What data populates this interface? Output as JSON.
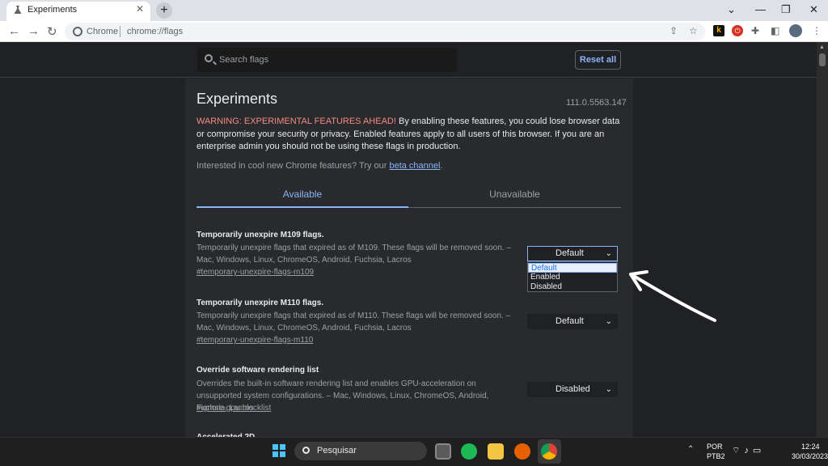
{
  "browser": {
    "tab_title": "Experiments",
    "tab_close": "✕",
    "new_tab": "+",
    "window_controls": {
      "dropdown": "⌄",
      "minimize": "—",
      "restore": "❐",
      "close": "✕"
    },
    "nav": {
      "back": "←",
      "forward": "→",
      "reload": "↻"
    },
    "omnibox": {
      "site": "Chrome",
      "url": "chrome://flags"
    },
    "extension_k_label": "k"
  },
  "flags": {
    "search_placeholder": "Search flags",
    "reset_label": "Reset all",
    "title": "Experiments",
    "version": "111.0.5563.147",
    "warning_prefix": "WARNING: EXPERIMENTAL FEATURES AHEAD!",
    "warning_body": " By enabling these features, you could lose browser data or compromise your security or privacy. Enabled features apply to all users of this browser. If you are an enterprise admin you should not be using these flags in production.",
    "interest_text": "Interested in cool new Chrome features? Try our ",
    "interest_link": "beta channel",
    "interest_end": ".",
    "tabs": {
      "available": "Available",
      "unavailable": "Unavailable"
    },
    "experiments": [
      {
        "title": "Temporarily unexpire M109 flags.",
        "desc": "Temporarily unexpire flags that expired as of M109. These flags will be removed soon. – Mac, Windows, Linux, ChromeOS, Android, Fuchsia, Lacros",
        "link": "#temporary-unexpire-flags-m109",
        "value": "Default"
      },
      {
        "title": "Temporarily unexpire M110 flags.",
        "desc": "Temporarily unexpire flags that expired as of M110. These flags will be removed soon. – Mac, Windows, Linux, ChromeOS, Android, Fuchsia, Lacros",
        "link": "#temporary-unexpire-flags-m110",
        "value": "Default"
      },
      {
        "title": "Override software rendering list",
        "desc": "Overrides the built-in software rendering list and enables GPU-acceleration on unsupported system configurations. – Mac, Windows, Linux, ChromeOS, Android, Fuchsia, Lacros",
        "link": "#ignore-gpu-blocklist",
        "value": "Disabled"
      }
    ],
    "dropdown_options": [
      "Default",
      "Enabled",
      "Disabled"
    ],
    "next_title_partial": "Accelerated 2D"
  },
  "taskbar": {
    "search_text": "Pesquisar",
    "lang_line1": "POR",
    "lang_line2": "PTB2",
    "time": "12:24",
    "date": "30/03/2023"
  },
  "colors": {
    "accent": "#8ab4f8",
    "warning": "#f28b82",
    "background": "#202124",
    "panel": "#292a2d"
  }
}
